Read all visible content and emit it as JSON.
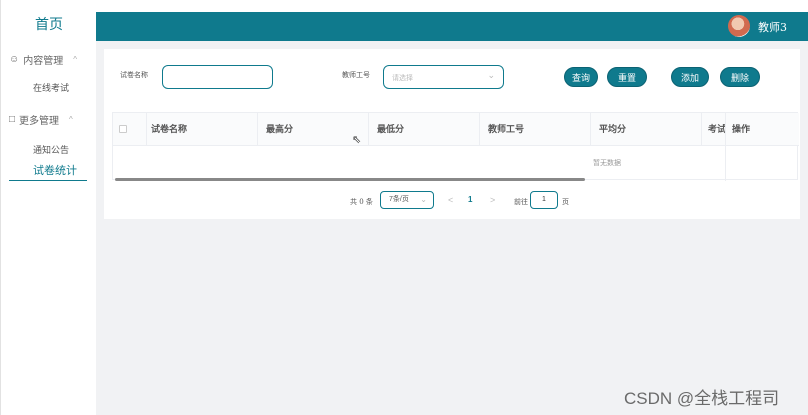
{
  "sidebar": {
    "brand": "首页",
    "groups": [
      {
        "label": "内容管理",
        "icon": "message-icon",
        "items": [
          "在线考试"
        ]
      },
      {
        "label": "更多管理",
        "icon": "copy-icon",
        "items": [
          "通知公告",
          "试卷统计"
        ]
      }
    ],
    "active_item": "试卷统计"
  },
  "header": {
    "username": "教师3"
  },
  "search": {
    "paper_name_label": "试卷名称",
    "paper_name_value": "",
    "teacher_id_label": "教师工号",
    "teacher_id_placeholder": "请选择"
  },
  "buttons": {
    "query": "查询",
    "reset": "重置",
    "add": "添加",
    "delete": "删除"
  },
  "table": {
    "columns": [
      "试卷名称",
      "最高分",
      "最低分",
      "教师工号",
      "平均分",
      "考试人数",
      "操作"
    ],
    "empty_text": "暂无数据"
  },
  "pagination": {
    "total": "共 0 条",
    "page_size": "7条/页",
    "prev": "<",
    "current": "1",
    "next": ">",
    "goto_label": "前往",
    "goto_value": "1",
    "page_suffix": "页"
  },
  "watermark": "CSDN @全栈工程司",
  "colors": {
    "primary": "#0f7a8d",
    "background": "#f1f2f4"
  }
}
